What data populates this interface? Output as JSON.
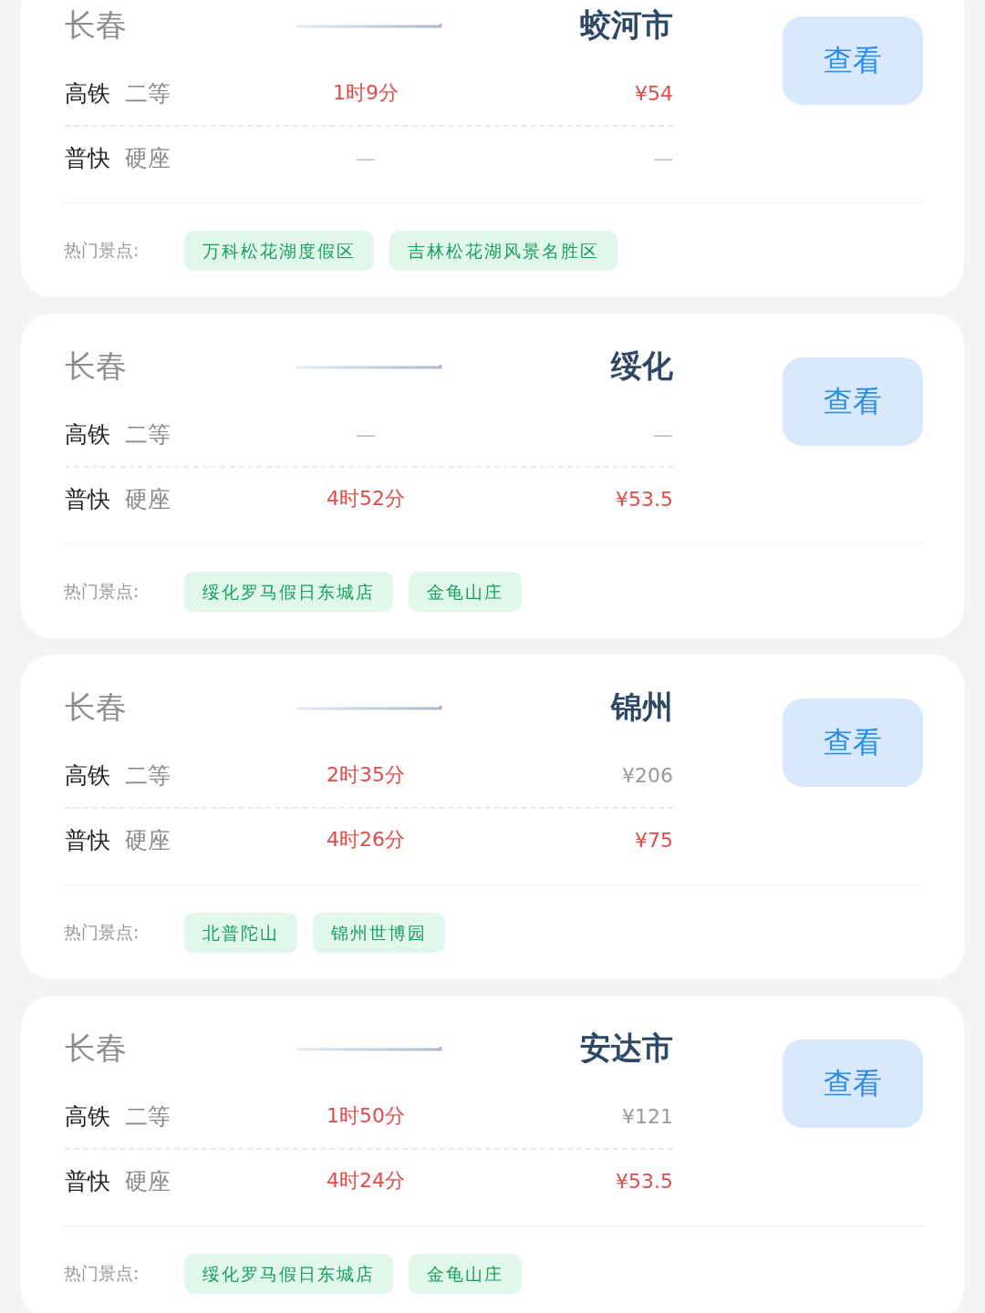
{
  "cards": [
    {
      "origin": "长春",
      "destination": "蛟河市",
      "rows": [
        {
          "train": "高铁",
          "seat": "二等",
          "available": true,
          "duration": "1时9分",
          "price": "¥54",
          "price_highlighted": true
        },
        {
          "train": "普快",
          "seat": "硬座",
          "available": false,
          "duration": "—",
          "price": "—"
        }
      ],
      "button": "查看",
      "attractions_label": "热门景点:",
      "attractions": [
        "万科松花湖度假区",
        "吉林松花湖风景名胜区"
      ]
    },
    {
      "origin": "长春",
      "destination": "绥化",
      "rows": [
        {
          "train": "高铁",
          "seat": "二等",
          "available": false,
          "duration": "—",
          "price": "—"
        },
        {
          "train": "普快",
          "seat": "硬座",
          "available": true,
          "duration": "4时52分",
          "price": "¥53.5",
          "price_highlighted": true
        }
      ],
      "button": "查看",
      "attractions_label": "热门景点:",
      "attractions": [
        "绥化罗马假日东城店",
        "金龟山庄"
      ]
    },
    {
      "origin": "长春",
      "destination": "锦州",
      "rows": [
        {
          "train": "高铁",
          "seat": "二等",
          "available": true,
          "duration": "2时35分",
          "price": "¥206",
          "price_highlighted": false
        },
        {
          "train": "普快",
          "seat": "硬座",
          "available": true,
          "duration": "4时26分",
          "price": "¥75",
          "price_highlighted": true
        }
      ],
      "button": "查看",
      "attractions_label": "热门景点:",
      "attractions": [
        "北普陀山",
        "锦州世博园"
      ]
    },
    {
      "origin": "长春",
      "destination": "安达市",
      "rows": [
        {
          "train": "高铁",
          "seat": "二等",
          "available": true,
          "duration": "1时50分",
          "price": "¥121",
          "price_highlighted": false
        },
        {
          "train": "普快",
          "seat": "硬座",
          "available": true,
          "duration": "4时24分",
          "price": "¥53.5",
          "price_highlighted": true
        }
      ],
      "button": "查看",
      "attractions_label": "热门景点:",
      "attractions": [
        "绥化罗马假日东城店",
        "金龟山庄"
      ]
    }
  ]
}
